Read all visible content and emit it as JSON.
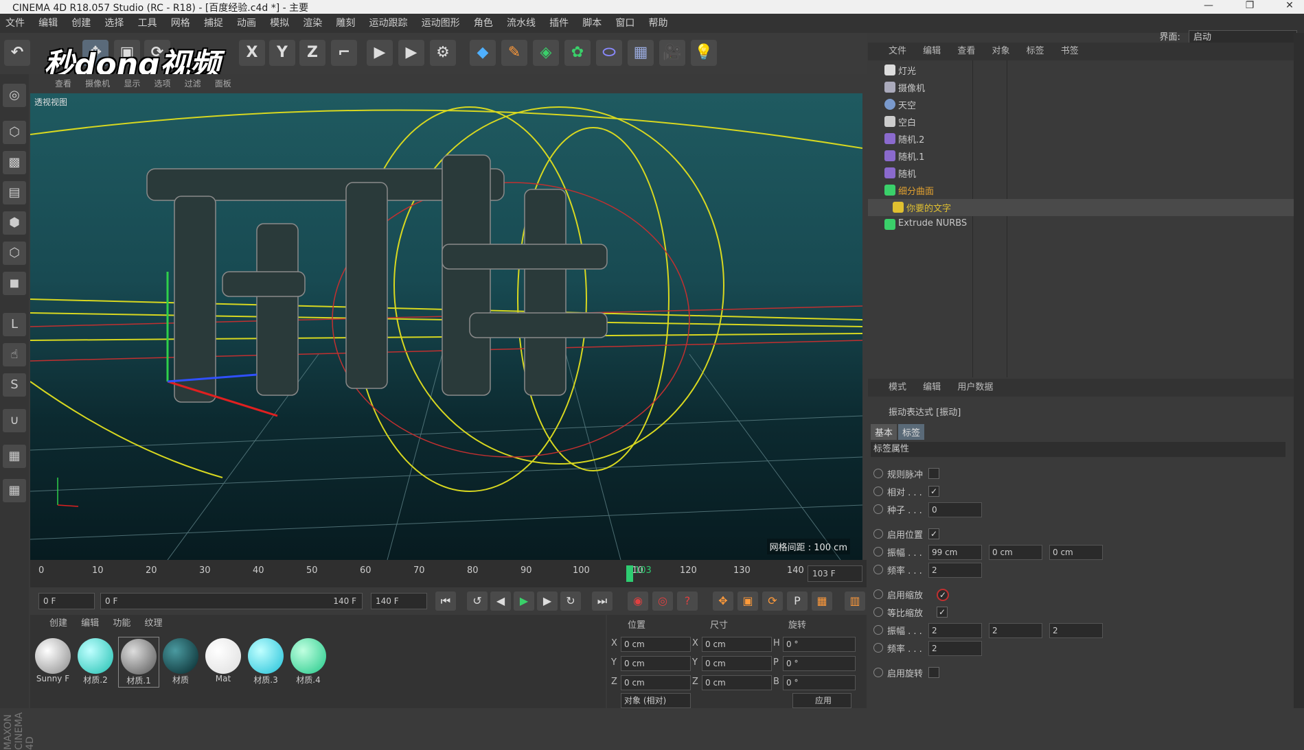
{
  "window": {
    "title": "CINEMA 4D R18.057 Studio (RC - R18) - [百度经验.c4d *] - 主要"
  },
  "menu": [
    "文件",
    "编辑",
    "创建",
    "选择",
    "工具",
    "网格",
    "捕捉",
    "动画",
    "模拟",
    "渲染",
    "雕刻",
    "运动跟踪",
    "运动图形",
    "角色",
    "流水线",
    "插件",
    "脚本",
    "窗口",
    "帮助"
  ],
  "layout": {
    "label": "界面:",
    "value": "启动"
  },
  "toolbar": {
    "x": "X",
    "y": "Y",
    "z": "Z"
  },
  "watermark": "秒dong视频",
  "viewport": {
    "menu": [
      "查看",
      "摄像机",
      "显示",
      "选项",
      "过滤",
      "面板"
    ],
    "label": "透视视图",
    "grid": "网格间距 : 100 cm"
  },
  "timeline": {
    "ticks": [
      "0",
      "10",
      "20",
      "30",
      "40",
      "50",
      "60",
      "70",
      "80",
      "90",
      "100",
      "110",
      "120",
      "130",
      "140"
    ],
    "current": "103",
    "frame": "103 F"
  },
  "transport": {
    "start": "0 F",
    "range_start": "0 F",
    "range_end": "140 F",
    "end": "140 F"
  },
  "materials": {
    "menu": [
      "创建",
      "编辑",
      "功能",
      "纹理"
    ],
    "items": [
      {
        "name": "Sunny F",
        "color": "#e8e8e8"
      },
      {
        "name": "材质.2",
        "color": "#2fe0d0"
      },
      {
        "name": "材质.1",
        "color": "#9a9a9a"
      },
      {
        "name": "材质",
        "color": "#0e4a50"
      },
      {
        "name": "Mat",
        "color": "#ffffff"
      },
      {
        "name": "材质.3",
        "color": "#2fd8e8"
      },
      {
        "name": "材质.4",
        "color": "#40e8a8"
      }
    ]
  },
  "coords": {
    "headers": {
      "pos": "位置",
      "size": "尺寸",
      "rot": "旋转"
    },
    "rows": [
      {
        "a1": "X",
        "v1": "0 cm",
        "a2": "X",
        "v2": "0 cm",
        "a3": "H",
        "v3": "0 °"
      },
      {
        "a1": "Y",
        "v1": "0 cm",
        "a2": "Y",
        "v2": "0 cm",
        "a3": "P",
        "v3": "0 °"
      },
      {
        "a1": "Z",
        "v1": "0 cm",
        "a2": "Z",
        "v2": "0 cm",
        "a3": "B",
        "v3": "0 °"
      }
    ],
    "mode": "对象 (相对)",
    "apply": "应用"
  },
  "objects": {
    "menu": [
      "文件",
      "编辑",
      "查看",
      "对象",
      "标签",
      "书签"
    ],
    "items": [
      "灯光",
      "摄像机",
      "天空",
      "空白",
      "随机.2",
      "随机.1",
      "随机",
      "细分曲面",
      "你要的文字",
      "Extrude NURBS"
    ]
  },
  "attributes": {
    "menu": [
      "模式",
      "编辑",
      "用户数据"
    ],
    "title": "振动表达式 [振动]",
    "tabs": [
      "基本",
      "标签"
    ],
    "section": "标签属性",
    "rows": [
      {
        "label": "规则脉冲",
        "check": ""
      },
      {
        "label": "相对 . . .",
        "check": "✓"
      },
      {
        "label": "种子 . . .",
        "field": "0"
      },
      {
        "label": "启用位置",
        "check": "✓"
      },
      {
        "label": "振幅 . . .",
        "f1": "99 cm",
        "f2": "0 cm",
        "f3": "0 cm"
      },
      {
        "label": "频率 . . .",
        "field": "2"
      },
      {
        "label": "启用缩放",
        "check": "✓"
      },
      {
        "label": "等比缩放",
        "check": "✓"
      },
      {
        "label": "振幅 . . .",
        "f1": "2",
        "f2": "2",
        "f3": "2"
      },
      {
        "label": "频率 . . .",
        "field": "2"
      },
      {
        "label": "启用旋转",
        "check": ""
      }
    ]
  },
  "maxon": "MAXON CINEMA 4D"
}
